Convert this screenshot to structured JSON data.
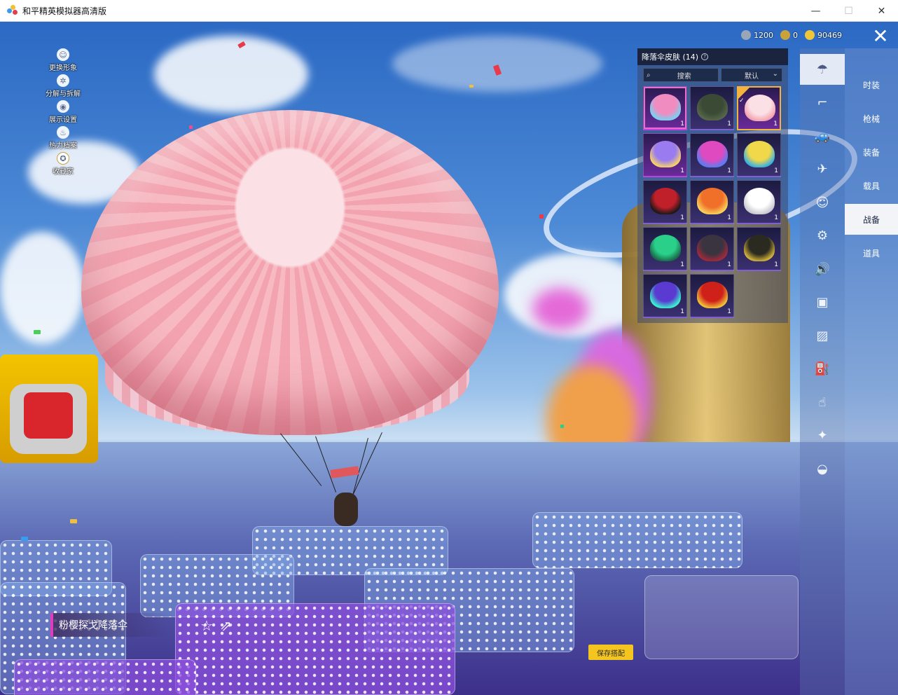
{
  "window": {
    "title": "和平精英模拟器高清版",
    "controls": {
      "minimize": "—",
      "maximize": "☐",
      "close": "✕"
    }
  },
  "left_menu": [
    {
      "label": "更换形象",
      "icon": "person-icon"
    },
    {
      "label": "分解与拆解",
      "icon": "gear-icon"
    },
    {
      "label": "展示设置",
      "icon": "eye-icon"
    },
    {
      "label": "热力档案",
      "icon": "flame-icon"
    },
    {
      "label": "收藏家",
      "icon": "medal-icon"
    }
  ],
  "currency": [
    {
      "value": "1200",
      "icon": "coupon-icon",
      "color": "#9aa6b8"
    },
    {
      "value": "0",
      "icon": "token-icon",
      "color": "#c9a23a"
    },
    {
      "value": "90469",
      "icon": "gold-coin-icon",
      "color": "#f0c636"
    }
  ],
  "close_label": "✕",
  "skin_panel": {
    "title": "降落伞皮肤 (14)",
    "search_label": "搜索",
    "sort_label": "默认",
    "items": [
      {
        "count": "1",
        "rarity": "epic",
        "colors": [
          "#f08cc0",
          "#7ad0f0"
        ],
        "state": "active"
      },
      {
        "count": "1",
        "rarity": "rare",
        "colors": [
          "#3b4a34",
          "#56664a"
        ],
        "state": ""
      },
      {
        "count": "1",
        "rarity": "epic",
        "colors": [
          "#fbe1e6",
          "#f3a3b0"
        ],
        "state": "selected"
      },
      {
        "count": "1",
        "rarity": "epic",
        "colors": [
          "#9a7cf0",
          "#f5d06a"
        ],
        "state": ""
      },
      {
        "count": "1",
        "rarity": "rare",
        "colors": [
          "#e04ac0",
          "#5a7cf0"
        ],
        "state": ""
      },
      {
        "count": "1",
        "rarity": "rare",
        "colors": [
          "#f0d84a",
          "#3ab0e0"
        ],
        "state": ""
      },
      {
        "count": "1",
        "rarity": "rare",
        "colors": [
          "#c0202a",
          "#201818"
        ],
        "state": ""
      },
      {
        "count": "1",
        "rarity": "rare",
        "colors": [
          "#f0702a",
          "#f8d05a"
        ],
        "state": ""
      },
      {
        "count": "1",
        "rarity": "rare",
        "colors": [
          "#ffffff",
          "#c8c8d0"
        ],
        "state": ""
      },
      {
        "count": "1",
        "rarity": "rare",
        "colors": [
          "#2ad08a",
          "#1a6a4a"
        ],
        "state": ""
      },
      {
        "count": "1",
        "rarity": "rare",
        "colors": [
          "#3a3440",
          "#a02a3a"
        ],
        "state": ""
      },
      {
        "count": "1",
        "rarity": "rare",
        "colors": [
          "#2a2a20",
          "#d0b03a"
        ],
        "state": ""
      },
      {
        "count": "1",
        "rarity": "rare",
        "colors": [
          "#5a3ad0",
          "#3af0d0"
        ],
        "state": ""
      },
      {
        "count": "1",
        "rarity": "rare",
        "colors": [
          "#d0201a",
          "#f0c03a"
        ],
        "state": ""
      }
    ]
  },
  "category_icons": [
    "parachute-icon",
    "gun-icon",
    "vehicle-icon",
    "plane-icon",
    "emote-icon",
    "robot-icon",
    "speaker-icon",
    "card-icon",
    "photo-icon",
    "extinguisher-icon",
    "hand-icon",
    "wand-icon",
    "ufo-icon"
  ],
  "category_tabs": [
    {
      "label": "时装"
    },
    {
      "label": "枪械"
    },
    {
      "label": "装备"
    },
    {
      "label": "载具"
    },
    {
      "label": "战备",
      "active": true
    },
    {
      "label": "道具"
    }
  ],
  "item_name": "粉樱探戈降落伞",
  "actions": {
    "favorite": "☆",
    "share": "⇗"
  },
  "save_button": "保存搭配"
}
